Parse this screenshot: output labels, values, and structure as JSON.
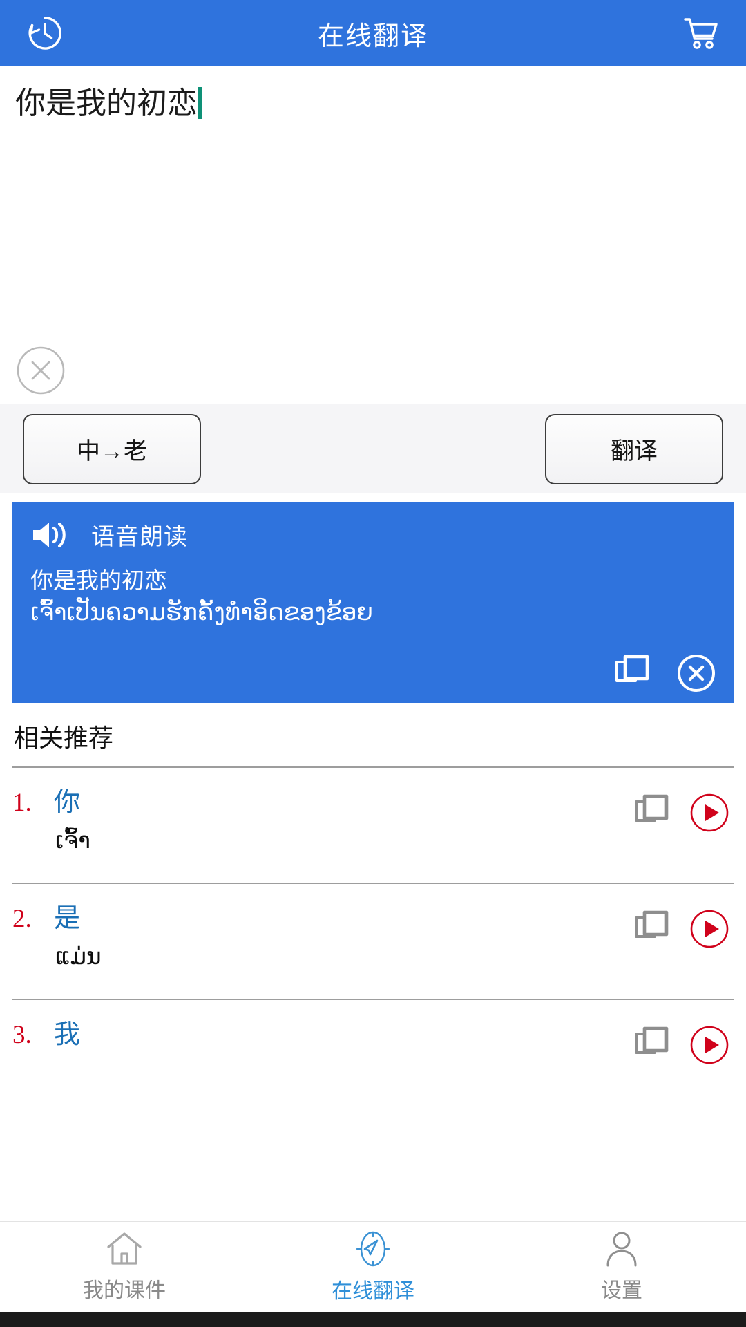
{
  "header": {
    "title": "在线翻译",
    "left_icon": "history-icon",
    "right_icon": "shopping-cart-icon",
    "background_color": "#2f73dd"
  },
  "input": {
    "value": "你是我的初恋",
    "placeholder": "",
    "caret_color": "#0e9177",
    "clear_icon": "circle-close-icon"
  },
  "actions": {
    "language_direction_label": "中→老",
    "translate_label": "翻译"
  },
  "result": {
    "speaker_icon": "speaker-icon",
    "speak_label": "语音朗读",
    "source_text": "你是我的初恋",
    "target_text": "ເຈົ້າເປັນຄວາມຮັກຄັ້ງທໍາອິດຂອງຂ້ອຍ",
    "copy_icon": "copy-icon",
    "close_icon": "circle-close-icon",
    "background_color": "#2f73dd"
  },
  "recommendations": {
    "title": "相关推荐",
    "items": [
      {
        "num": "1.",
        "zh": "你",
        "lo": "ເຈົ້າ",
        "copy_icon": "copy-icon",
        "play_icon": "play-icon"
      },
      {
        "num": "2.",
        "zh": "是",
        "lo": "ແມ່ນ",
        "copy_icon": "copy-icon",
        "play_icon": "play-icon"
      },
      {
        "num": "3.",
        "zh": "我",
        "lo": "",
        "copy_icon": "copy-icon",
        "play_icon": "play-icon"
      }
    ],
    "num_color": "#d0021b",
    "zh_color": "#1a6fb5",
    "play_color": "#d0021b"
  },
  "bottom_nav": {
    "items": [
      {
        "label": "我的课件",
        "icon": "home-icon",
        "active": false
      },
      {
        "label": "在线翻译",
        "icon": "compass-icon",
        "active": true
      },
      {
        "label": "设置",
        "icon": "person-icon",
        "active": false
      }
    ],
    "active_color": "#2f8fd8",
    "inactive_color": "#8a8a8a"
  }
}
